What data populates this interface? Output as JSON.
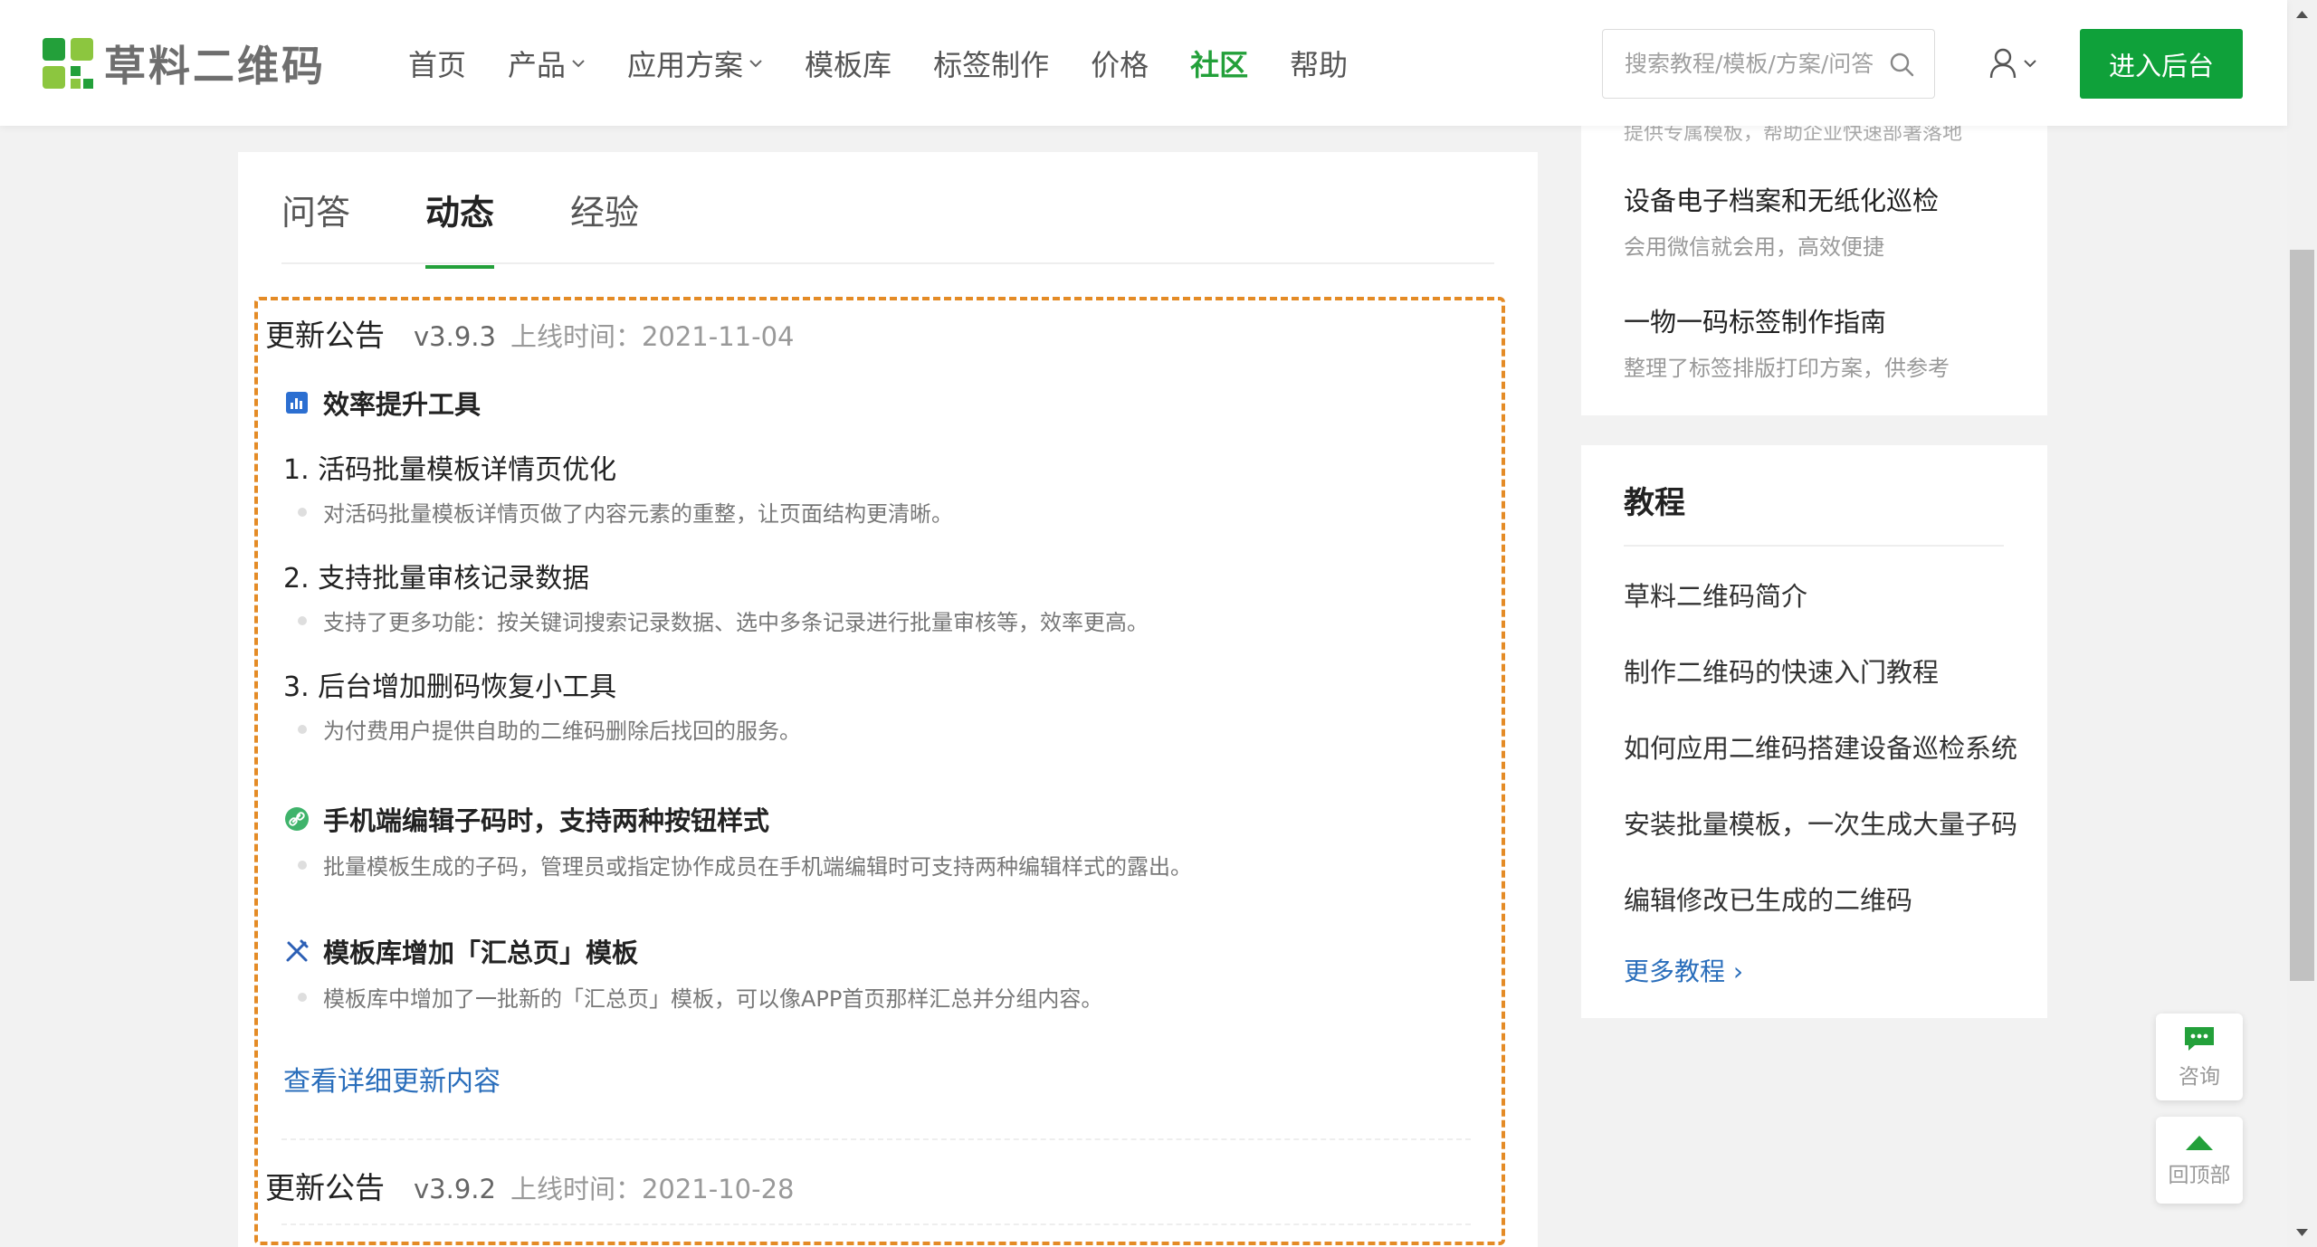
{
  "header": {
    "logo_text": "草料二维码",
    "nav": [
      {
        "label": "首页"
      },
      {
        "label": "产品"
      },
      {
        "label": "应用方案"
      },
      {
        "label": "模板库"
      },
      {
        "label": "标签制作"
      },
      {
        "label": "价格"
      },
      {
        "label": "社区"
      },
      {
        "label": "帮助"
      }
    ],
    "search_placeholder": "搜索教程/模板/方案/问答",
    "cta_label": "进入后台",
    "brand_color": "#0fa13a"
  },
  "main": {
    "tabs": [
      {
        "label": "问答"
      },
      {
        "label": "动态"
      },
      {
        "label": "经验"
      }
    ],
    "active_tab": "动态",
    "entries": [
      {
        "title": "更新公告",
        "version": "v3.9.3",
        "date": "上线时间：2021-11-04",
        "sections": [
          {
            "icon": "chart-icon",
            "title": "效率提升工具",
            "items": [
              {
                "title": "1. 活码批量模板详情页优化",
                "desc": "对活码批量模板详情页做了内容元素的重整，让页面结构更清晰。"
              },
              {
                "title": "2. 支持批量审核记录数据",
                "desc": "支持了更多功能：按关键词搜索记录数据、选中多条记录进行批量审核等，效率更高。"
              },
              {
                "title": "3. 后台增加删码恢复小工具",
                "desc": "为付费用户提供自助的二维码删除后找回的服务。"
              }
            ]
          },
          {
            "icon": "link-icon",
            "title": "手机端编辑子码时，支持两种按钮样式",
            "desc": "批量模板生成的子码，管理员或指定协作成员在手机端编辑时可支持两种编辑样式的露出。"
          },
          {
            "icon": "tools-icon",
            "title": "模板库增加「汇总页」模板",
            "desc": "模板库中增加了一批新的「汇总页」模板，可以像APP首页那样汇总并分组内容。"
          }
        ],
        "more_link": "查看详细更新内容"
      },
      {
        "title": "更新公告",
        "version": "v3.9.2",
        "date": "上线时间：2021-10-28"
      }
    ]
  },
  "sidebar": {
    "cut_text": "提供专属模板，帮助企业快速部署落地",
    "recommend": [
      {
        "title": "设备电子档案和无纸化巡检",
        "desc": "会用微信就会用，高效便捷"
      },
      {
        "title": "一物一码标签制作指南",
        "desc": "整理了标签排版打印方案，供参考"
      }
    ],
    "tutorials": {
      "heading": "教程",
      "links": [
        "草料二维码简介",
        "制作二维码的快速入门教程",
        "如何应用二维码搭建设备巡检系统",
        "安装批量模板，一次生成大量子码",
        "编辑修改已生成的二维码"
      ],
      "more": "更多教程 ›"
    }
  },
  "floating": {
    "consult_label": "咨询",
    "top_label": "回顶部"
  }
}
